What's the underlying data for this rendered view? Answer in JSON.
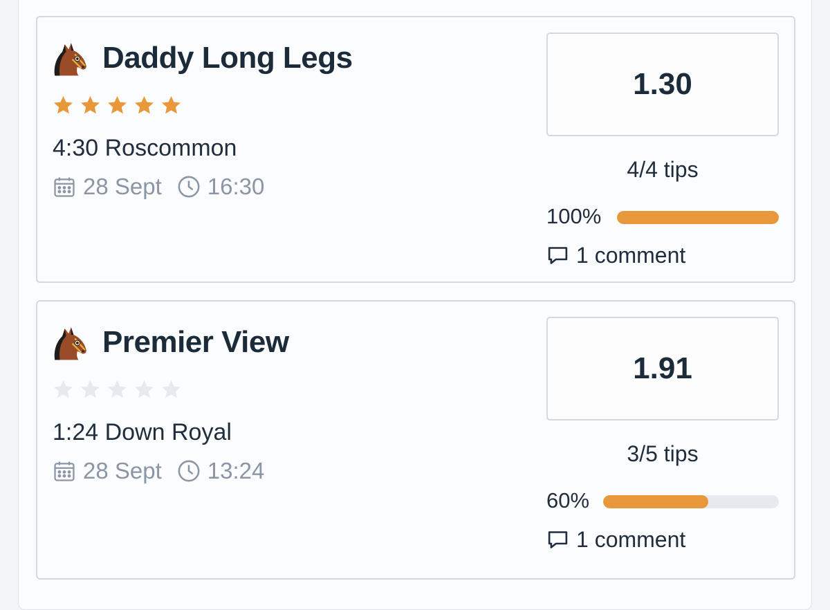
{
  "colors": {
    "accent": "#e8983a",
    "star_empty": "#e6eaee",
    "muted_text": "#8a95a5",
    "heading": "#1c2b3a"
  },
  "tips": [
    {
      "horse": "Daddy Long Legs",
      "horse_icon": "horse-head-icon",
      "rating": 5,
      "rating_max": 5,
      "race": "4:30 Roscommon",
      "date": "28 Sept",
      "time": "16:30",
      "odds": "1.30",
      "tips_label": "4/4 tips",
      "percent_label": "100%",
      "percent": 100,
      "comments_label": "1 comment"
    },
    {
      "horse": "Premier View",
      "horse_icon": "horse-head-icon",
      "rating": 0,
      "rating_max": 5,
      "race": "1:24 Down Royal",
      "date": "28 Sept",
      "time": "13:24",
      "odds": "1.91",
      "tips_label": "3/5 tips",
      "percent_label": "60%",
      "percent": 60,
      "comments_label": "1 comment"
    }
  ]
}
